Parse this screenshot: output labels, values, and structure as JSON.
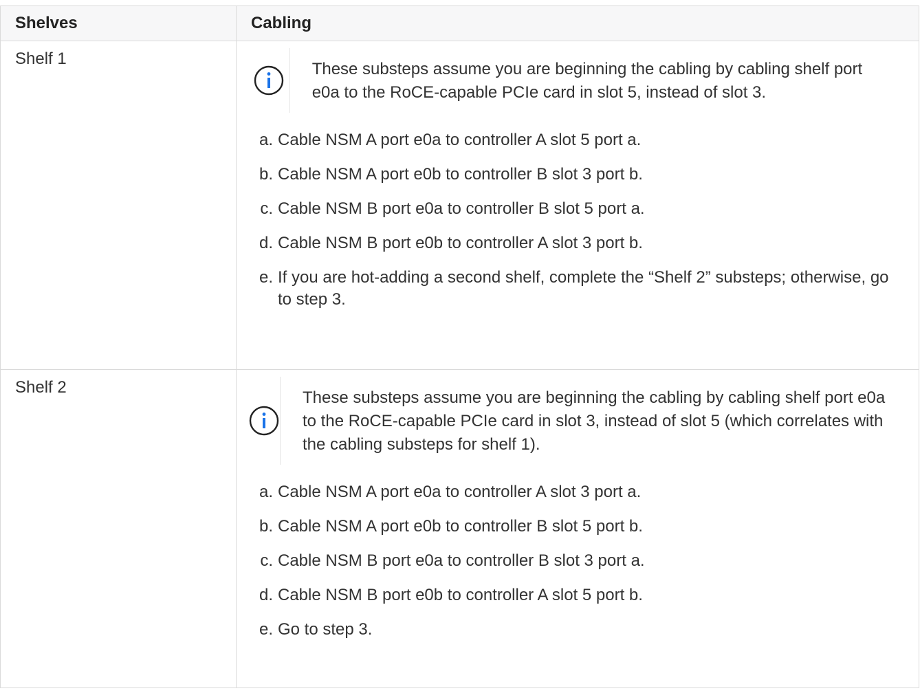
{
  "header": {
    "col1": "Shelves",
    "col2": "Cabling"
  },
  "rows": [
    {
      "shelf": "Shelf 1",
      "note": "These substeps assume you are beginning the cabling by cabling shelf port e0a to the RoCE-capable PCIe card in slot 5, instead of slot 3.",
      "steps": [
        {
          "marker": "a.",
          "text": "Cable NSM A port e0a to controller A slot 5 port a."
        },
        {
          "marker": "b.",
          "text": "Cable NSM A port e0b to controller B slot 3 port b."
        },
        {
          "marker": "c.",
          "text": "Cable NSM B port e0a to controller B slot 5 port a."
        },
        {
          "marker": "d.",
          "text": "Cable NSM B port e0b to controller A slot 3 port b."
        },
        {
          "marker": "e.",
          "text": "If you are hot-adding a second shelf, complete the “Shelf 2” substeps; otherwise, go to step 3."
        }
      ]
    },
    {
      "shelf": "Shelf 2",
      "note": "These substeps assume you are beginning the cabling by cabling shelf port e0a to the RoCE-capable PCIe card in slot 3, instead of slot 5 (which correlates with the cabling substeps for shelf 1).",
      "steps": [
        {
          "marker": "a.",
          "text": "Cable NSM A port e0a to controller A slot 3 port a."
        },
        {
          "marker": "b.",
          "text": "Cable NSM A port e0b to controller B slot 5 port b."
        },
        {
          "marker": "c.",
          "text": "Cable NSM B port e0a to controller B slot 3 port a."
        },
        {
          "marker": "d.",
          "text": "Cable NSM B port e0b to controller A slot 5 port b."
        },
        {
          "marker": "e.",
          "text": "Go to step 3."
        }
      ]
    }
  ],
  "icons": {
    "note_icon": "info-icon"
  },
  "colors": {
    "accent": "#1a73e8",
    "border": "#dadada",
    "header_bg": "#f7f7f8"
  }
}
